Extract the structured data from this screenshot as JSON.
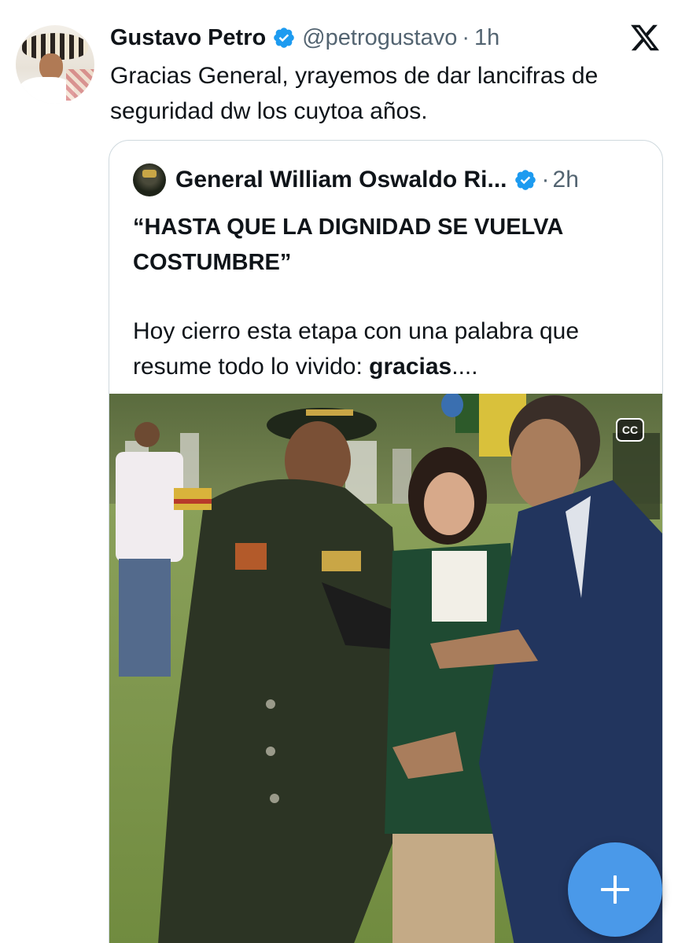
{
  "tweet": {
    "author_name": "Gustavo Petro",
    "handle": "@petrogustavo",
    "separator": "·",
    "time": "1h",
    "text": "Gracias General, yrayemos de dar lancifras de seguridad dw los cuytoa años."
  },
  "quoted_tweet": {
    "author_name": "General William Oswaldo Ri...",
    "separator": "·",
    "time": "2h",
    "title": "“HASTA QUE LA DIGNIDAD SE VUELVA COSTUMBRE”",
    "body_prefix": "Hoy cierro esta etapa con una palabra que resume todo lo vivido: ",
    "body_bold": "gracias",
    "body_suffix": "....",
    "media": {
      "type": "video",
      "cc_label": "CC"
    }
  },
  "icons": {
    "verified": "verified-badge-icon",
    "brand": "x-logo-icon",
    "compose": "plus-icon"
  },
  "colors": {
    "verified_blue": "#1d9bf0",
    "fab_blue": "#4a99e9",
    "secondary_text": "#536471",
    "border": "#cfd9de"
  }
}
